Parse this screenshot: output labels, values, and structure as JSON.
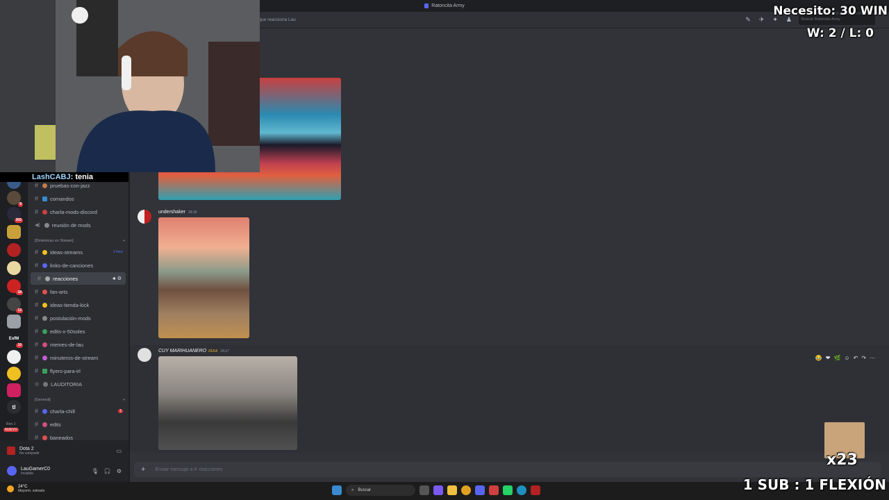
{
  "window": {
    "title": "Ratoncita Army"
  },
  "header": {
    "topic": "n que reacciona Lau",
    "search_placeholder": "Buscar Ratoncita Army"
  },
  "webcam_chat": {
    "nick": "LashCABJ",
    "message": " : tenia"
  },
  "servers": [
    {
      "badge": ""
    },
    {
      "badge": "9"
    },
    {
      "badge": "305"
    },
    {
      "badge": ""
    },
    {
      "badge": ""
    },
    {
      "badge": ""
    },
    {
      "badge": "18"
    },
    {
      "badge": "13"
    },
    {
      "badge": ""
    },
    {
      "badge": "10"
    },
    {
      "badge": ""
    },
    {
      "badge": ""
    },
    {
      "badge": ""
    },
    {
      "badge": ""
    }
  ],
  "server_labels": {
    "tl": "tl",
    "esf": "EsfM",
    "nuevo": "NUEVO",
    "ron": "Ron J"
  },
  "channels": [
    {
      "label": "pruebas-con-jazz"
    },
    {
      "label": "comandos"
    },
    {
      "label": "charla-mods-discord"
    },
    {
      "label": "reunión de mods"
    },
    {
      "label": "ideas-streams",
      "note": "1 New"
    },
    {
      "label": "links-de-canciones"
    },
    {
      "label": "reacciones"
    },
    {
      "label": "fan-arts"
    },
    {
      "label": "ideas-tienda-kick"
    },
    {
      "label": "postulación-mods"
    },
    {
      "label": "edits-x-50soles"
    },
    {
      "label": "memes-de-lau"
    },
    {
      "label": "minuteros-de-stream"
    },
    {
      "label": "flyers-para-irl"
    },
    {
      "label": "LAUDITORIA"
    },
    {
      "label": "charla-chill",
      "badge": "1"
    },
    {
      "label": "edits"
    },
    {
      "label": "baneados"
    }
  ],
  "categories": {
    "dynamics": "[Dinámicas en Stream]",
    "general": "[General]"
  },
  "voice": {
    "activity": "Dota 2",
    "status": "No compartir"
  },
  "user": {
    "name": "LauGamerC0",
    "status": "Invisible"
  },
  "messages": [
    {
      "author": "undershaker",
      "time": "18:16"
    },
    {
      "author": "CUY MARIHUANERO",
      "tag": "FEKA",
      "time": "18:17"
    }
  ],
  "composer": {
    "placeholder": "Enviar mensaje a #",
    "channel": "reacciones"
  },
  "taskbar": {
    "temp": "24°C",
    "weather": "Mayorm. soleado",
    "search": "Buscar"
  },
  "overlay": {
    "goal": "Necesito: 30 WIN",
    "record": "W: 2 / L: 0",
    "emote_count": "x23",
    "sub_rule": "1 SUB : 1 FLEXIÓN"
  },
  "colors": {
    "accent": "#5865f2",
    "badge": "#da373c",
    "channels_bg": "#2b2d31",
    "chat_bg": "#313338"
  }
}
